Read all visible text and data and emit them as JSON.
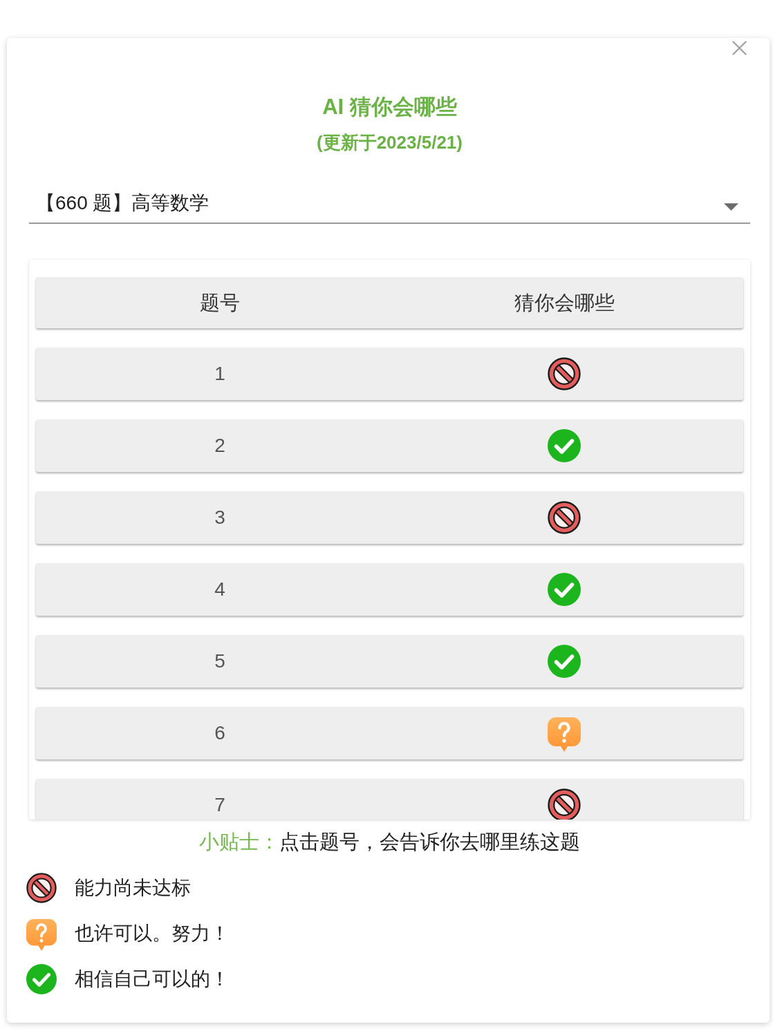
{
  "title": "AI 猜你会哪些",
  "subtitle": "(更新于2023/5/21)",
  "select": {
    "value": "【660 题】高等数学"
  },
  "table": {
    "columns": [
      "题号",
      "猜你会哪些"
    ],
    "rows": [
      {
        "number": "1",
        "kind": "not_yet"
      },
      {
        "number": "2",
        "kind": "yes"
      },
      {
        "number": "3",
        "kind": "not_yet"
      },
      {
        "number": "4",
        "kind": "yes"
      },
      {
        "number": "5",
        "kind": "yes"
      },
      {
        "number": "6",
        "kind": "maybe"
      },
      {
        "number": "7",
        "kind": "not_yet"
      }
    ]
  },
  "tip": {
    "label": "小贴士：",
    "text": "点击题号，会告诉你去哪里练这题"
  },
  "legend": [
    {
      "kind": "not_yet",
      "label": "能力尚未达标"
    },
    {
      "kind": "maybe",
      "label": "也许可以。努力！"
    },
    {
      "kind": "yes",
      "label": "相信自己可以的！"
    }
  ]
}
